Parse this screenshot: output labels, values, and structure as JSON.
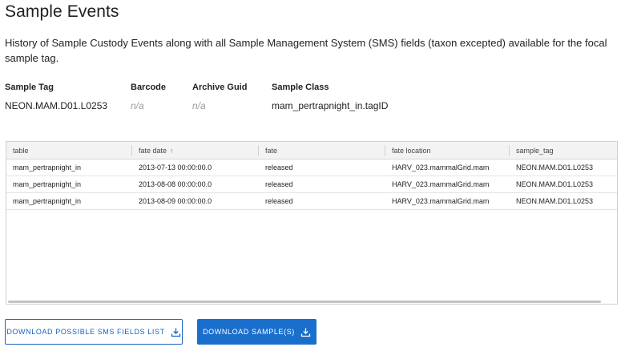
{
  "page": {
    "title": "Sample Events",
    "description": "History of Sample Custody Events along with all Sample Management System (SMS) fields (taxon excepted) available for the focal sample tag."
  },
  "meta": {
    "sample_tag_label": "Sample Tag",
    "sample_tag_value": "NEON.MAM.D01.L0253",
    "barcode_label": "Barcode",
    "barcode_value": "n/a",
    "archive_guid_label": "Archive Guid",
    "archive_guid_value": "n/a",
    "sample_class_label": "Sample Class",
    "sample_class_value": "mam_pertrapnight_in.tagID"
  },
  "table": {
    "columns": [
      "table",
      "fate date",
      "fate",
      "fate location",
      "sample_tag"
    ],
    "sort_icon": "arrow-up-icon",
    "rows": [
      [
        "mam_pertrapnight_in",
        "2013-07-13 00:00:00.0",
        "released",
        "HARV_023.mammalGrid.mam",
        "NEON.MAM.D01.L0253"
      ],
      [
        "mam_pertrapnight_in",
        "2013-08-08 00:00:00.0",
        "released",
        "HARV_023.mammalGrid.mam",
        "NEON.MAM.D01.L0253"
      ],
      [
        "mam_pertrapnight_in",
        "2013-08-09 00:00:00.0",
        "released",
        "HARV_023.mammalGrid.mam",
        "NEON.MAM.D01.L0253"
      ]
    ]
  },
  "buttons": {
    "download_fields_label": "DOWNLOAD POSSIBLE SMS FIELDS LIST",
    "download_samples_label": "DOWNLOAD SAMPLE(S)",
    "icon": "download-icon"
  },
  "colors": {
    "primary": "#1a6fcc",
    "header_bg": "#f3f3f3",
    "muted": "#9a9a9a"
  }
}
